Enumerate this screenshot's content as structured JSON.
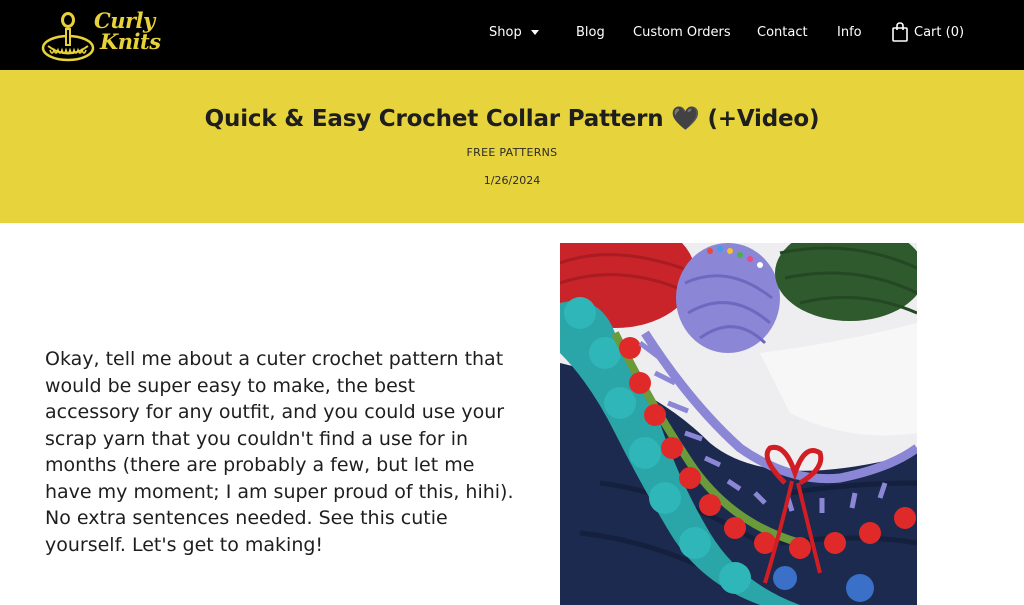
{
  "site": {
    "logo_text_line1": "Curly",
    "logo_text_line2": "Knits"
  },
  "nav": {
    "items": [
      {
        "label": "Shop"
      },
      {
        "label": "Blog"
      },
      {
        "label": "Custom Orders"
      },
      {
        "label": "Contact"
      },
      {
        "label": "Info"
      }
    ],
    "cart_label": "Cart (0)"
  },
  "post": {
    "title": "Quick & Easy Crochet Collar Pattern 🖤 (+Video)",
    "category": "FREE PATTERNS",
    "date": "1/26/2024",
    "intro": "Okay, tell me about a cuter crochet pattern that would be super easy to make, the best accessory for any outfit, and you could use your scrap yarn that you couldn't find a use for in months (there are probably a few, but let me have my moment; I am super proud of this, hihi). No extra sentences needed. See this cutie yourself. Let's get to making!"
  },
  "colors": {
    "header_bg": "#000000",
    "band_bg": "#e7d33c",
    "logo_yellow": "#e8d23a"
  },
  "icons": {
    "cart": "shopping-bag-icon",
    "shop_dropdown": "chevron-down-icon"
  }
}
